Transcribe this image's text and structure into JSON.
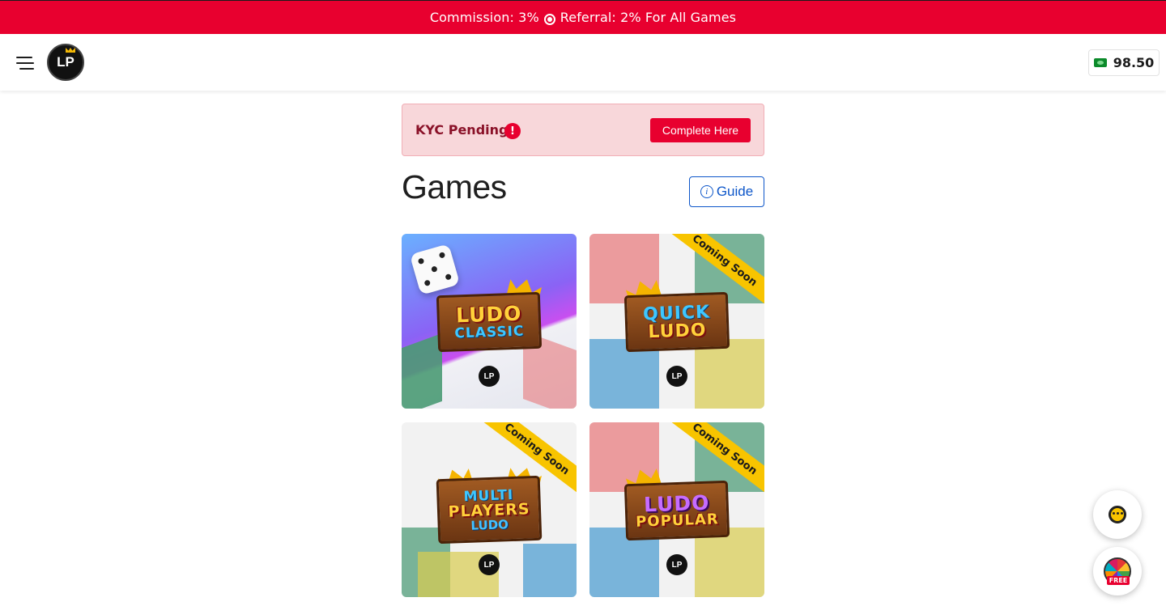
{
  "banner": {
    "commission": "Commission: 3%",
    "referral": "Referral: 2% For All Games"
  },
  "header": {
    "logo_text": "LP",
    "wallet_amount": "98.50"
  },
  "kyc": {
    "label": "KYC Pending",
    "alert_glyph": "!",
    "button_label": "Complete Here"
  },
  "games": {
    "title": "Games",
    "guide_label": "Guide",
    "items": [
      {
        "line1": "LUDO",
        "line2": "CLASSIC",
        "line3": "",
        "ribbon": ""
      },
      {
        "line1": "QUICK",
        "line2": "LUDO",
        "line3": "",
        "ribbon": "Coming Soon"
      },
      {
        "line1": "MULTI",
        "line2": "PLAYERS",
        "line3": "LUDO",
        "ribbon": "Coming Soon"
      },
      {
        "line1": "LUDO",
        "line2": "POPULAR",
        "line3": "",
        "ribbon": "Coming Soon"
      }
    ]
  },
  "floating": {
    "spin_tag": "FREE"
  },
  "icons": {
    "menu": "hamburger-icon",
    "wallet": "cash-icon",
    "kyc": "exclamation-icon",
    "guide": "info-icon",
    "support": "support-chat-icon",
    "spin": "spin-wheel-icon"
  },
  "colors": {
    "brand_red": "#e8002f",
    "kyc_bg": "#f8d7da",
    "guide_blue": "#0d56c9",
    "ribbon_yellow": "#f8c400"
  }
}
